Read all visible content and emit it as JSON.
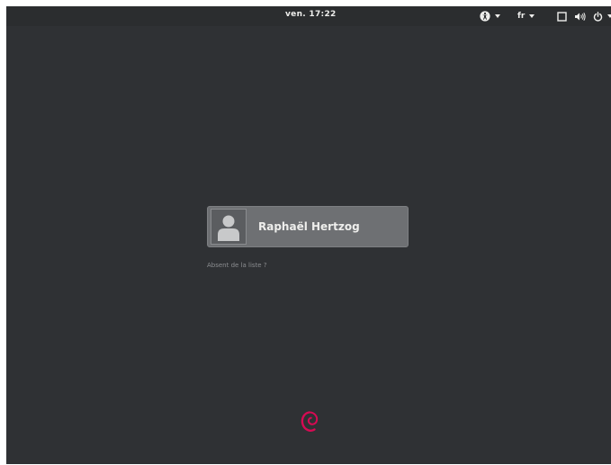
{
  "topbar": {
    "clock": "ven. 17:22",
    "language": "fr",
    "accessibility_icon": "accessibility-icon",
    "window_icon": "window-icon",
    "volume_icon": "volume-icon",
    "power_icon": "power-icon"
  },
  "login": {
    "user_name": "Raphaël Hertzog",
    "avatar_icon": "user-avatar-icon",
    "not_listed_link": "Absent de la liste ?"
  },
  "branding": {
    "logo": "debian-swirl-logo"
  },
  "colors": {
    "background": "#2f3134",
    "panel": "#2b2d2f",
    "user_entry": "#6e7073",
    "text": "#eeeeec",
    "debian_red": "#d70a53"
  }
}
